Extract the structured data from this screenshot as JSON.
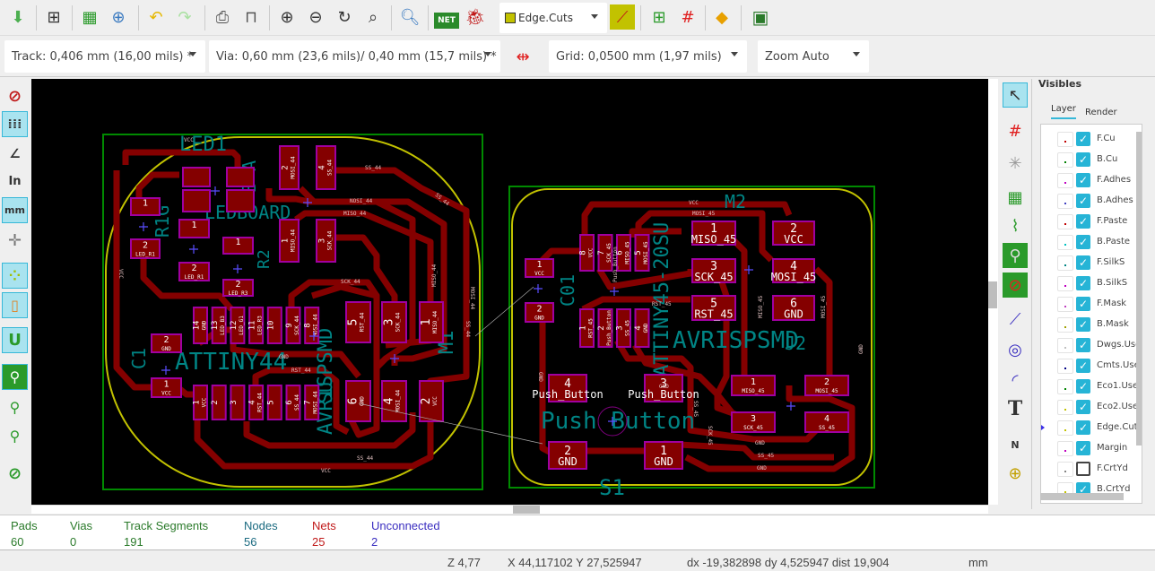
{
  "toolbar": {
    "icons": [
      "save-board-icon",
      "page-settings-icon",
      "library-editor-icon",
      "library-browser-icon",
      "undo-icon",
      "redo-icon",
      "print-icon",
      "plot-icon",
      "zoom-in-icon",
      "zoom-out-icon",
      "redraw-icon",
      "zoom-fit-icon",
      "find-icon",
      "netlist-icon",
      "drc-icon"
    ],
    "layer_select": "Edge.Cuts",
    "layer_color": "#c2c200",
    "right_icons": [
      "layer-pair-icon",
      "autoplace-icon",
      "autoroute-icon",
      "microwave-icon",
      "scripting-console-icon"
    ],
    "net_label": "NET"
  },
  "options": {
    "track": "Track: 0,406 mm (16,00 mils) *",
    "via": "Via: 0,60 mm (23,6 mils)/ 0,40 mm (15,7 mils) *",
    "grid": "Grid: 0,0500 mm (1,97 mils)",
    "zoom": "Zoom Auto"
  },
  "left_toolbar": {
    "inches": "In",
    "mm": "mm"
  },
  "right_toolbar": {
    "text_tool": "T",
    "dimension_label": "N"
  },
  "visibles": {
    "title": "Visibles",
    "tabs": [
      "Layer",
      "Render"
    ],
    "active_tab": "Layer",
    "active_layer": "Edge.Cuts",
    "layers": [
      {
        "name": "F.Cu",
        "visible": true,
        "color": "#c00000"
      },
      {
        "name": "B.Cu",
        "visible": true,
        "color": "#008000"
      },
      {
        "name": "F.Adhes",
        "visible": true,
        "color": "#c000c0"
      },
      {
        "name": "B.Adhes",
        "visible": true,
        "color": "#4040c0"
      },
      {
        "name": "F.Paste",
        "visible": true,
        "color": "#c00000"
      },
      {
        "name": "B.Paste",
        "visible": true,
        "color": "#00c0c0"
      },
      {
        "name": "F.SilkS",
        "visible": true,
        "color": "#008484"
      },
      {
        "name": "B.SilkS",
        "visible": true,
        "color": "#c000c0"
      },
      {
        "name": "F.Mask",
        "visible": true,
        "color": "#c040c0"
      },
      {
        "name": "B.Mask",
        "visible": true,
        "color": "#a0a000"
      },
      {
        "name": "Dwgs.User",
        "visible": true,
        "color": "#c0c0c0"
      },
      {
        "name": "Cmts.User",
        "visible": true,
        "color": "#000084"
      },
      {
        "name": "Eco1.User",
        "visible": true,
        "color": "#008400"
      },
      {
        "name": "Eco2.User",
        "visible": true,
        "color": "#c2c200"
      },
      {
        "name": "Edge.Cuts",
        "visible": true,
        "color": "#c2c200"
      },
      {
        "name": "Margin",
        "visible": true,
        "color": "#c000c0"
      },
      {
        "name": "F.CrtYd",
        "visible": false,
        "color": "#848484"
      },
      {
        "name": "B.CrtYd",
        "visible": true,
        "color": "#c2c200"
      }
    ]
  },
  "pcb": {
    "silk": [
      "LED1",
      "R1G",
      "LEDBOARD",
      "R2",
      "B A",
      "ATTINY44",
      "AVRISPSMD",
      "C1",
      "SU",
      "M1",
      "ATTINY45-20SU",
      "M2",
      "C01",
      "AVRISPSMD",
      "J2",
      "Push Button",
      "S1"
    ],
    "pads": [
      {
        "num": "",
        "net": ""
      },
      {
        "num": "",
        "net": ""
      },
      {
        "num": "",
        "net": ""
      },
      {
        "num": "",
        "net": ""
      },
      {
        "num": "1",
        "net": ""
      },
      {
        "num": "2",
        "net": "LED_R1"
      },
      {
        "num": "1",
        "net": ""
      },
      {
        "num": "2",
        "net": "LED_R1"
      },
      {
        "num": "1",
        "net": ""
      },
      {
        "num": "2",
        "net": "LED_R3"
      },
      {
        "num": "2",
        "net": "MOSI_44"
      },
      {
        "num": "4",
        "net": "SS_44"
      },
      {
        "num": "1",
        "net": "MISO_44"
      },
      {
        "num": "3",
        "net": "SCK_44"
      },
      {
        "num": "14",
        "net": "GND"
      },
      {
        "num": "13",
        "net": "LED_B3"
      },
      {
        "num": "12",
        "net": "LED_G1"
      },
      {
        "num": "11",
        "net": "LED_R3"
      },
      {
        "num": "10",
        "net": ""
      },
      {
        "num": "9",
        "net": "SCK_44"
      },
      {
        "num": "8",
        "net": "MOSI_44"
      },
      {
        "num": "1",
        "net": "VCC"
      },
      {
        "num": "2",
        "net": ""
      },
      {
        "num": "3",
        "net": ""
      },
      {
        "num": "4",
        "net": "RST_44"
      },
      {
        "num": "5",
        "net": ""
      },
      {
        "num": "6",
        "net": "SS_44"
      },
      {
        "num": "7",
        "net": "MOSI_44"
      },
      {
        "num": "5",
        "net": "RST_44"
      },
      {
        "num": "3",
        "net": "SCK_44"
      },
      {
        "num": "1",
        "net": "MISO_44"
      },
      {
        "num": "6",
        "net": "GND"
      },
      {
        "num": "4",
        "net": "MOSI_44"
      },
      {
        "num": "2",
        "net": "VCC"
      },
      {
        "num": "2",
        "net": "GND"
      },
      {
        "num": "1",
        "net": "VCC"
      },
      {
        "num": "1",
        "net": "VCC"
      },
      {
        "num": "2",
        "net": "GND"
      },
      {
        "num": "8",
        "net": "VCC"
      },
      {
        "num": "7",
        "net": "SCK_45"
      },
      {
        "num": "6",
        "net": "MISO_45"
      },
      {
        "num": "5",
        "net": "MOSI_45"
      },
      {
        "num": "1",
        "net": "RST_45"
      },
      {
        "num": "2",
        "net": "Push_Button"
      },
      {
        "num": "3",
        "net": "SS_45"
      },
      {
        "num": "4",
        "net": "GND"
      },
      {
        "num": "1",
        "net": "MISO_45"
      },
      {
        "num": "2",
        "net": "VCC"
      },
      {
        "num": "3",
        "net": "SCK_45"
      },
      {
        "num": "4",
        "net": "MOSI_45"
      },
      {
        "num": "5",
        "net": "RST_45"
      },
      {
        "num": "6",
        "net": "GND"
      },
      {
        "num": "1",
        "net": "MISO_45"
      },
      {
        "num": "2",
        "net": "MOSI_45"
      },
      {
        "num": "3",
        "net": "SCK_45"
      },
      {
        "num": "4",
        "net": "SS_45"
      },
      {
        "num": "4",
        "net": "Push_Button"
      },
      {
        "num": "3",
        "net": "Push_Button"
      },
      {
        "num": "2",
        "net": "GND"
      },
      {
        "num": "1",
        "net": "GND"
      }
    ],
    "track_labels": [
      "VCC",
      "SS_44",
      "NOSI_44",
      "MISO_44",
      "SS_44",
      "SCK_44",
      "MISO_44",
      "MOSI_44",
      "SS_44",
      "GND",
      "RST_44",
      "SS_44",
      "VCC",
      "VCC",
      "VCC",
      "MOSI_45",
      "RST_45",
      "Push_Button",
      "GND",
      "GND",
      "SS_45",
      "GND",
      "SCK_45",
      "MISO_45",
      "MOSI_45",
      "GND",
      "SS_45",
      "GND"
    ],
    "colors": {
      "copper": "#840000",
      "pad_outline": "#a000a0",
      "silk": "#008484",
      "edge": "#c2c200",
      "margin": "#008a00"
    }
  },
  "stats": {
    "items": [
      {
        "label": "Pads",
        "value": "60",
        "color": "#2a7a2a"
      },
      {
        "label": "Vias",
        "value": "0",
        "color": "#2a7a2a"
      },
      {
        "label": "Track Segments",
        "value": "191",
        "color": "#2a7a2a"
      },
      {
        "label": "Nodes",
        "value": "56",
        "color": "#1a6a80"
      },
      {
        "label": "Nets",
        "value": "25",
        "color": "#c01818"
      },
      {
        "label": "Unconnected",
        "value": "2",
        "color": "#3a2ec0"
      }
    ]
  },
  "status": {
    "zoom": "Z 4,77",
    "xy": "X 44,117102  Y 27,525947",
    "delta": "dx -19,382898  dy 4,525947  dist 19,904",
    "units": "mm"
  }
}
